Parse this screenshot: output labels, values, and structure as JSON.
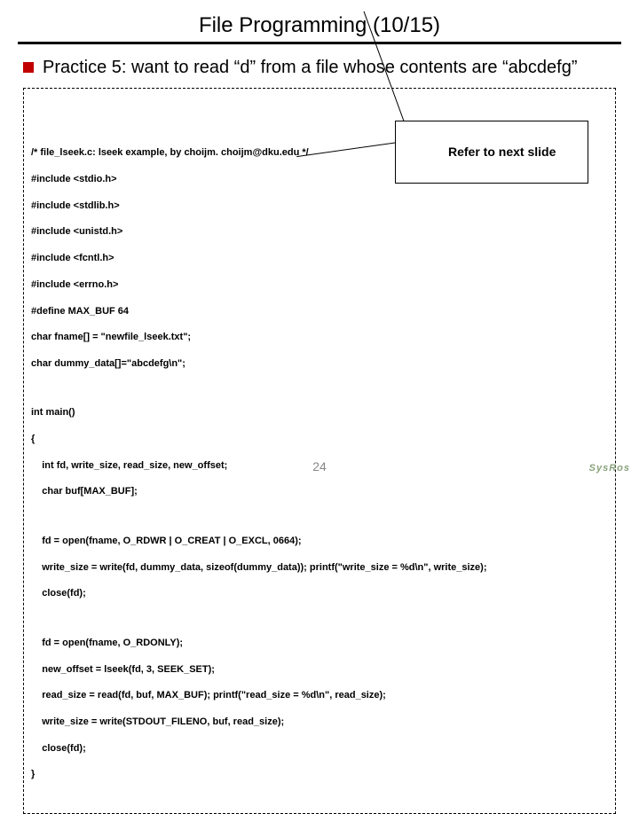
{
  "title": "File Programming (10/15)",
  "bullet": "Practice 5: want to read “d” from a file whose contents are “abcdefg”",
  "callout": "Refer to next slide",
  "page_num": "24",
  "logo": "SysRos",
  "code": {
    "l1": "/* file_lseek.c: lseek example, by choijm. choijm@dku.edu */",
    "l2": "#include <stdio.h>",
    "l3": "#include <stdlib.h>",
    "l4": "#include <unistd.h>",
    "l5": "#include <fcntl.h>",
    "l6": "#include <errno.h>",
    "l7": "#define MAX_BUF 64",
    "l8": "char fname[] = \"newfile_lseek.txt\";",
    "l9": "char dummy_data[]=\"abcdefg\\n\";",
    "l10": "int main()",
    "l11": "{",
    "l12": "    int fd, write_size, read_size, new_offset;",
    "l13": "    char buf[MAX_BUF];",
    "l14": "    fd = open(fname, O_RDWR | O_CREAT | O_EXCL, 0664);",
    "l15": "    write_size = write(fd, dummy_data, sizeof(dummy_data)); printf(\"write_size = %d\\n\", write_size);",
    "l16": "    close(fd);",
    "l17": "    fd = open(fname, O_RDONLY);",
    "l18": "    new_offset = lseek(fd, 3, SEEK_SET);",
    "l19": "    read_size = read(fd, buf, MAX_BUF); printf(\"read_size = %d\\n\", read_size);",
    "l20": "    write_size = write(STDOUT_FILENO, buf, read_size);",
    "l21": "    close(fd);",
    "l22": "}"
  }
}
